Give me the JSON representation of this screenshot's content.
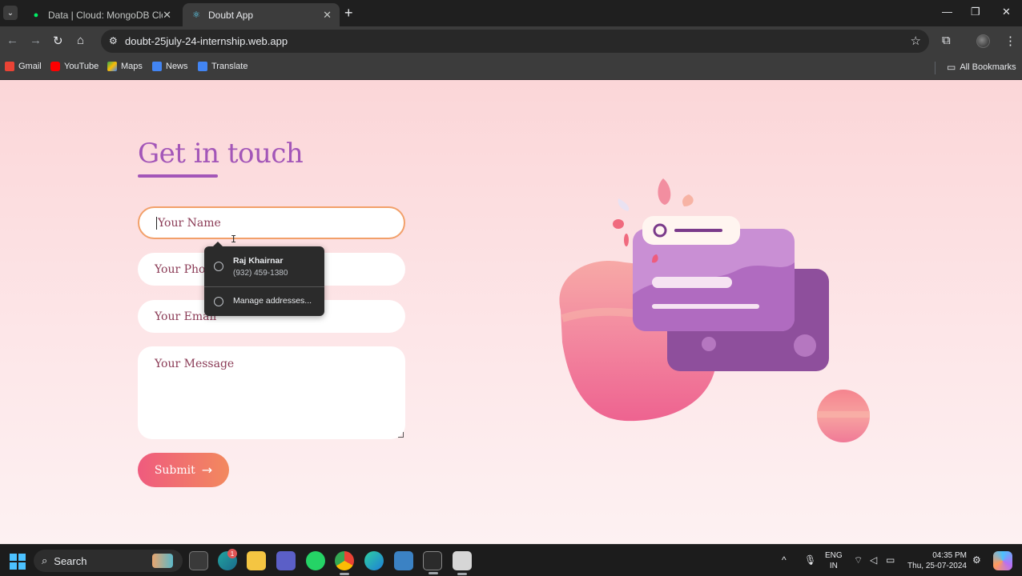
{
  "browser": {
    "tabs": [
      {
        "label": "Data | Cloud: MongoDB Cloud",
        "close": "✕"
      },
      {
        "label": "Doubt App",
        "close": "✕"
      }
    ],
    "new_tab": "+",
    "window": {
      "minimize": "—",
      "restore": "❐",
      "close": "✕"
    },
    "url": "doubt-25july-24-internship.web.app",
    "bookmarks": [
      {
        "label": "Gmail",
        "color": "#ea4335"
      },
      {
        "label": "YouTube",
        "color": "#ff0000"
      },
      {
        "label": "Maps",
        "color": "#34a853"
      },
      {
        "label": "News",
        "color": "#4285f4"
      },
      {
        "label": "Translate",
        "color": "#4285f4"
      }
    ],
    "all_bookmarks": "All Bookmarks"
  },
  "form": {
    "title": "Get in touch",
    "name_placeholder": "Your Name",
    "phone_placeholder": "Your Phone",
    "email_placeholder": "Your Email",
    "message_placeholder": "Your Message",
    "submit_label": "Submit",
    "submit_arrow": "→"
  },
  "autofill": {
    "name": "Raj Khairnar",
    "phone": "(932) 459-1380",
    "manage": "Manage addresses..."
  },
  "taskbar": {
    "search": "Search",
    "notification_count": "1",
    "lang_line1": "ENG",
    "lang_line2": "IN",
    "time": "04:35 PM",
    "date": "Thu, 25-07-2024"
  },
  "colors": {
    "accent": "#a356b8",
    "submit_start": "#ef5b7e",
    "submit_end": "#f2895e",
    "focus_border": "#f2a06a"
  }
}
